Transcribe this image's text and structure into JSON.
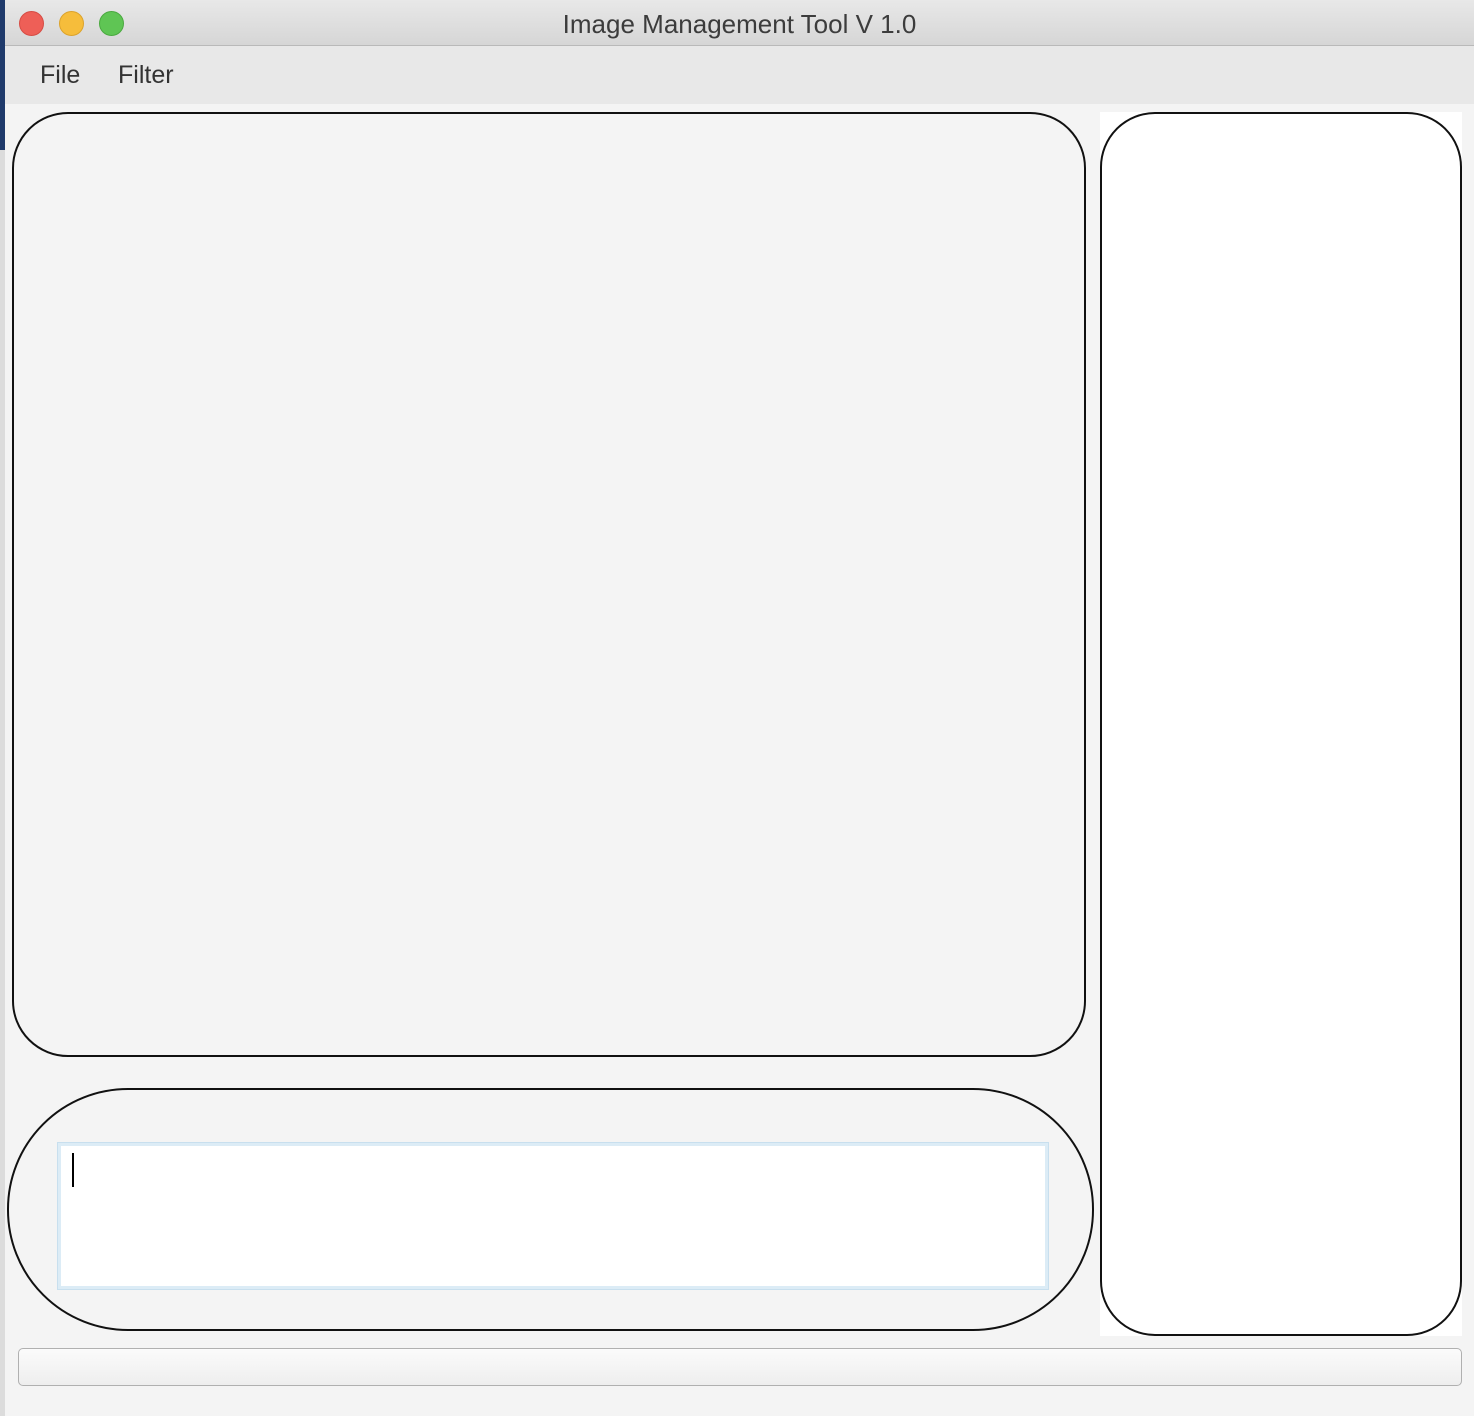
{
  "window": {
    "title": "Image Management Tool V 1.0"
  },
  "menu": {
    "items": [
      {
        "label": "File"
      },
      {
        "label": "Filter"
      }
    ]
  },
  "text_input": {
    "value": "",
    "placeholder": ""
  },
  "status_bar": {
    "text": ""
  },
  "icons": [
    "close-icon",
    "minimize-icon",
    "zoom-icon"
  ]
}
